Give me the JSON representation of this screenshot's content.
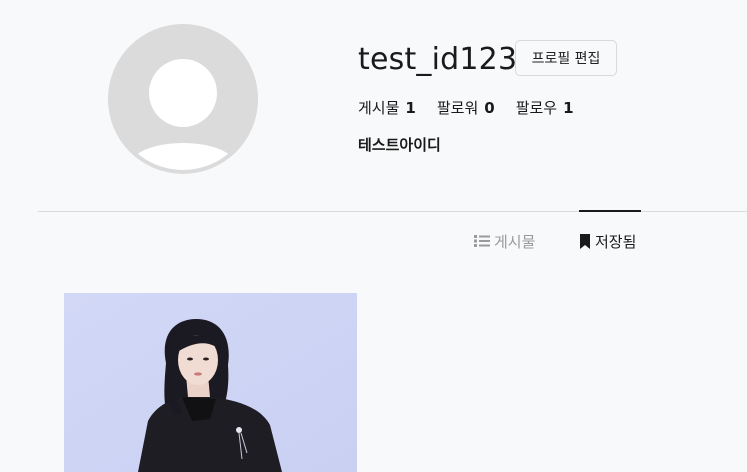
{
  "profile": {
    "username": "test_id123",
    "edit_label": "프로필 편집",
    "display_name": "테스트아이디",
    "stats": [
      {
        "label": "게시물",
        "value": "1"
      },
      {
        "label": "팔로워",
        "value": "0"
      },
      {
        "label": "팔로우",
        "value": "1"
      }
    ]
  },
  "tabs": [
    {
      "label": "게시물",
      "icon": "list-icon",
      "active": false
    },
    {
      "label": "저장됨",
      "icon": "bookmark-icon",
      "active": true
    }
  ],
  "colors": {
    "background": "#f8f9fa",
    "avatar_placeholder": "#dbdbdb",
    "active_tab": "#1a1a1a",
    "inactive_tab": "#9a9a9a"
  }
}
